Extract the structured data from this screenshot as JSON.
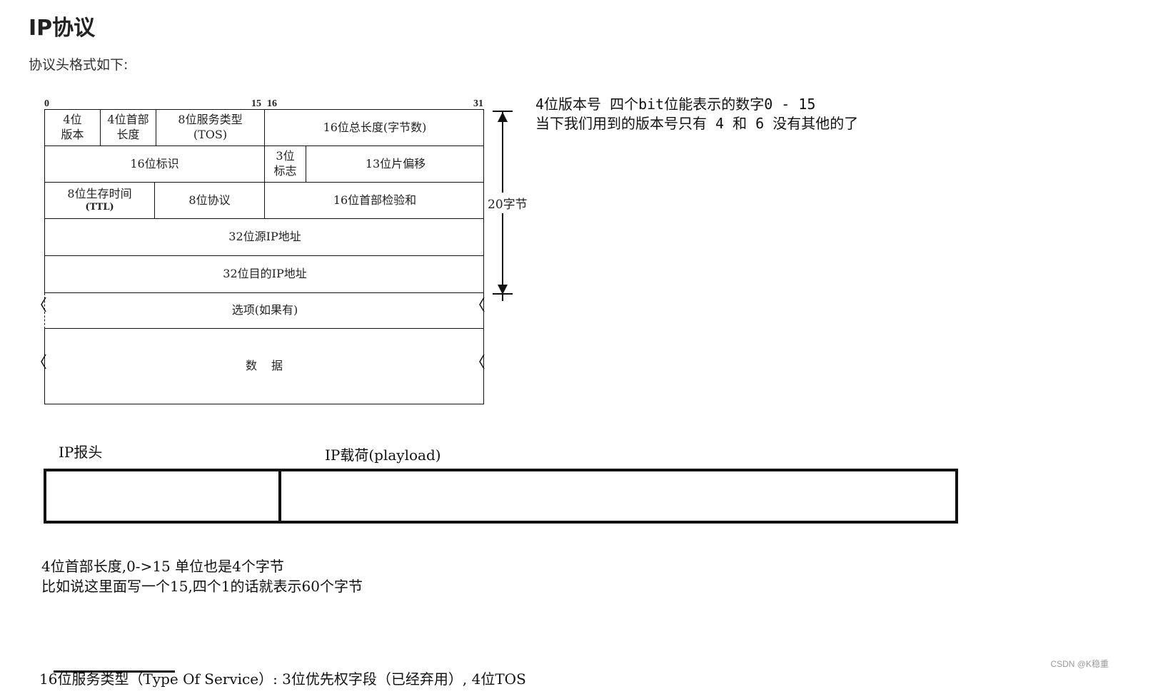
{
  "page": {
    "title": "IP协议",
    "intro": "协议头格式如下:"
  },
  "diagram": {
    "bits": {
      "b0": "0",
      "b15": "15",
      "b16": "16",
      "b31": "31"
    },
    "row1": {
      "version_line1": "4位",
      "version_line2": "版本",
      "hlen_line1": "4位首部",
      "hlen_line2": "长度",
      "tos_line1": "8位服务类型",
      "tos_line2": "(TOS)",
      "total_length": "16位总长度(字节数)"
    },
    "row2": {
      "identification": "16位标识",
      "flags_line1": "3位",
      "flags_line2": "标志",
      "fragment_offset": "13位片偏移"
    },
    "row3": {
      "ttl_line1": "8位生存时间",
      "ttl_line2": "(TTL)",
      "protocol": "8位协议",
      "checksum": "16位首部检验和"
    },
    "src_addr": "32位源IP地址",
    "dst_addr": "32位目的IP地址",
    "options": "选项(如果有)",
    "data": "数　据",
    "bytes_label": "20字节"
  },
  "notes": {
    "version_line1": "4位版本号 四个bit位能表示的数字0 - 15",
    "version_line2": "当下我们用到的版本号只有 4 和 6 没有其他的了",
    "header_label": "IP报头",
    "payload_label": "IP载荷(playload)",
    "hlen_line1": "4位首部长度,0->15 单位也是4个字节",
    "hlen_line2": "比如说这里面写一个15,四个1的话就表示60个字节",
    "cutoff_text": "16位服务类型（Type Of Service）: 3位优先权字段（已经弃用）, 4位TOS"
  },
  "watermark": "CSDN @K稳重"
}
